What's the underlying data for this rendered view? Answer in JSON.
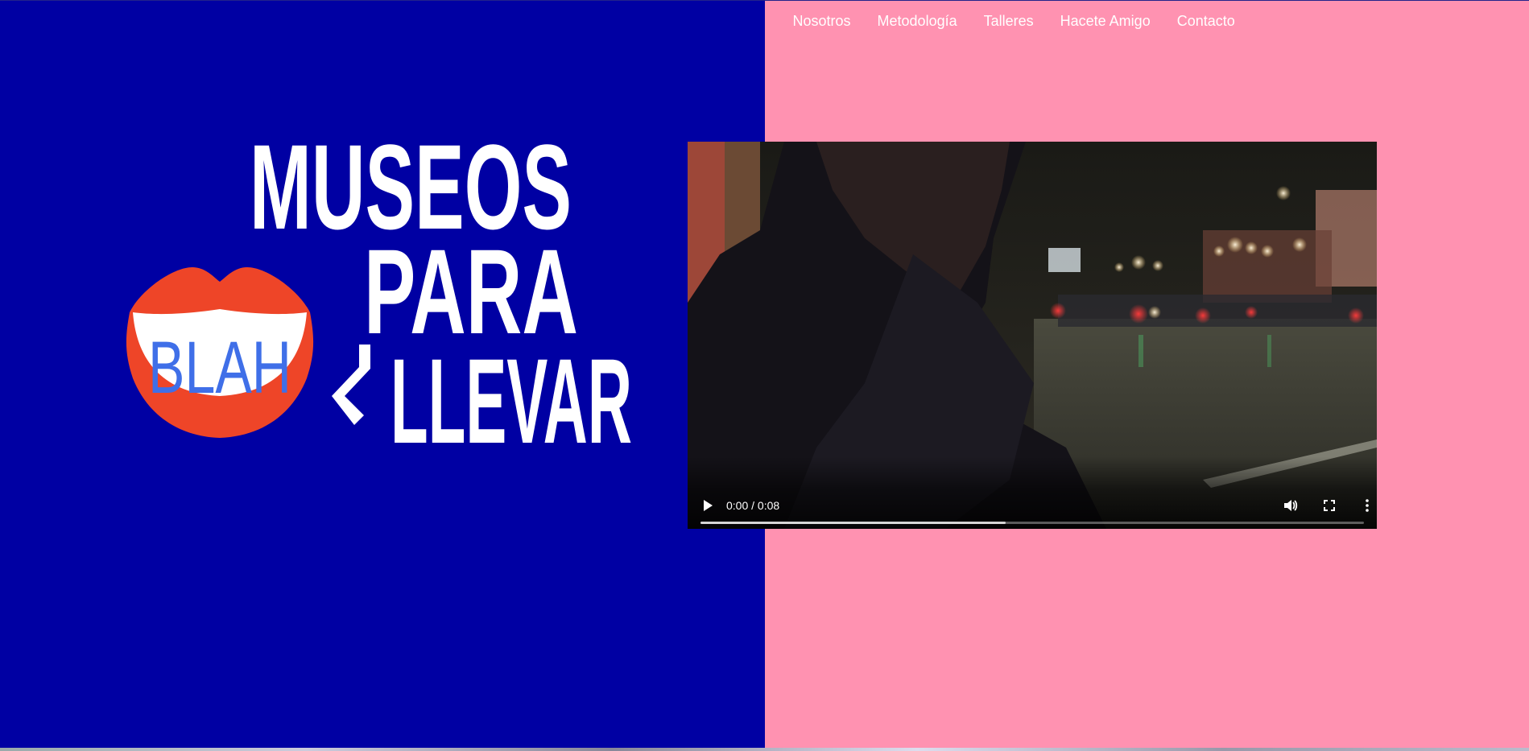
{
  "nav": {
    "items": [
      {
        "label": "Nosotros"
      },
      {
        "label": "Metodología"
      },
      {
        "label": "Talleres"
      },
      {
        "label": "Hacete Amigo"
      },
      {
        "label": "Contacto"
      }
    ]
  },
  "logo": {
    "line1": "MUSEOS",
    "line2": "PARA",
    "line3": "LLEVAR",
    "question_mark": "¿",
    "lips_text": "BLAH"
  },
  "video": {
    "time": "0:00 / 0:08",
    "buffered_fraction": 0.46,
    "icons": [
      "play-icon",
      "volume-icon",
      "fullscreen-icon",
      "more-options-icon"
    ]
  },
  "colors": {
    "left_bg": "#0000a3",
    "right_bg": "#ff92b1",
    "lips": "#ee4528",
    "lips_text": "#3f6fe8",
    "title_text": "#ffffff"
  }
}
